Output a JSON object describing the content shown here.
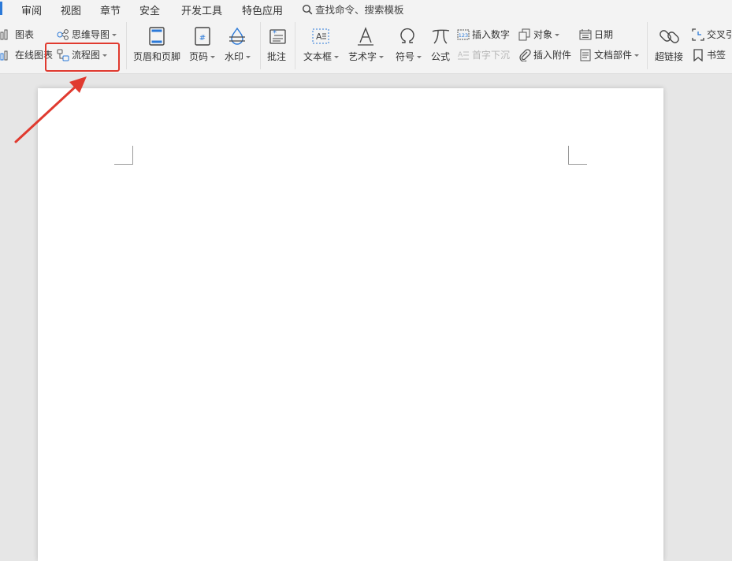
{
  "menu": {
    "items": [
      "审阅",
      "视图",
      "章节",
      "安全",
      "开发工具",
      "特色应用"
    ],
    "search_label": "查找命令、搜索模板"
  },
  "ribbon": {
    "chart": "图表",
    "online_chart": "在线图表",
    "mind_map": "思维导图",
    "flowchart": "流程图",
    "header_footer": "页眉和页脚",
    "page_number": "页码",
    "watermark": "水印",
    "comment": "批注",
    "text_box": "文本框",
    "word_art": "艺术字",
    "symbol": "符号",
    "formula": "公式",
    "insert_number": "插入数字",
    "drop_cap": "首字下沉",
    "object": "对象",
    "attachment": "插入附件",
    "date": "日期",
    "doc_parts": "文档部件",
    "hyperlink": "超链接",
    "cross_reference": "交叉引",
    "bookmark": "书签",
    "number_icon_text": "123",
    "page_number_icon_text": "#"
  },
  "colors": {
    "accent_blue": "#2b79d8",
    "highlight_red": "#e03a2f"
  }
}
